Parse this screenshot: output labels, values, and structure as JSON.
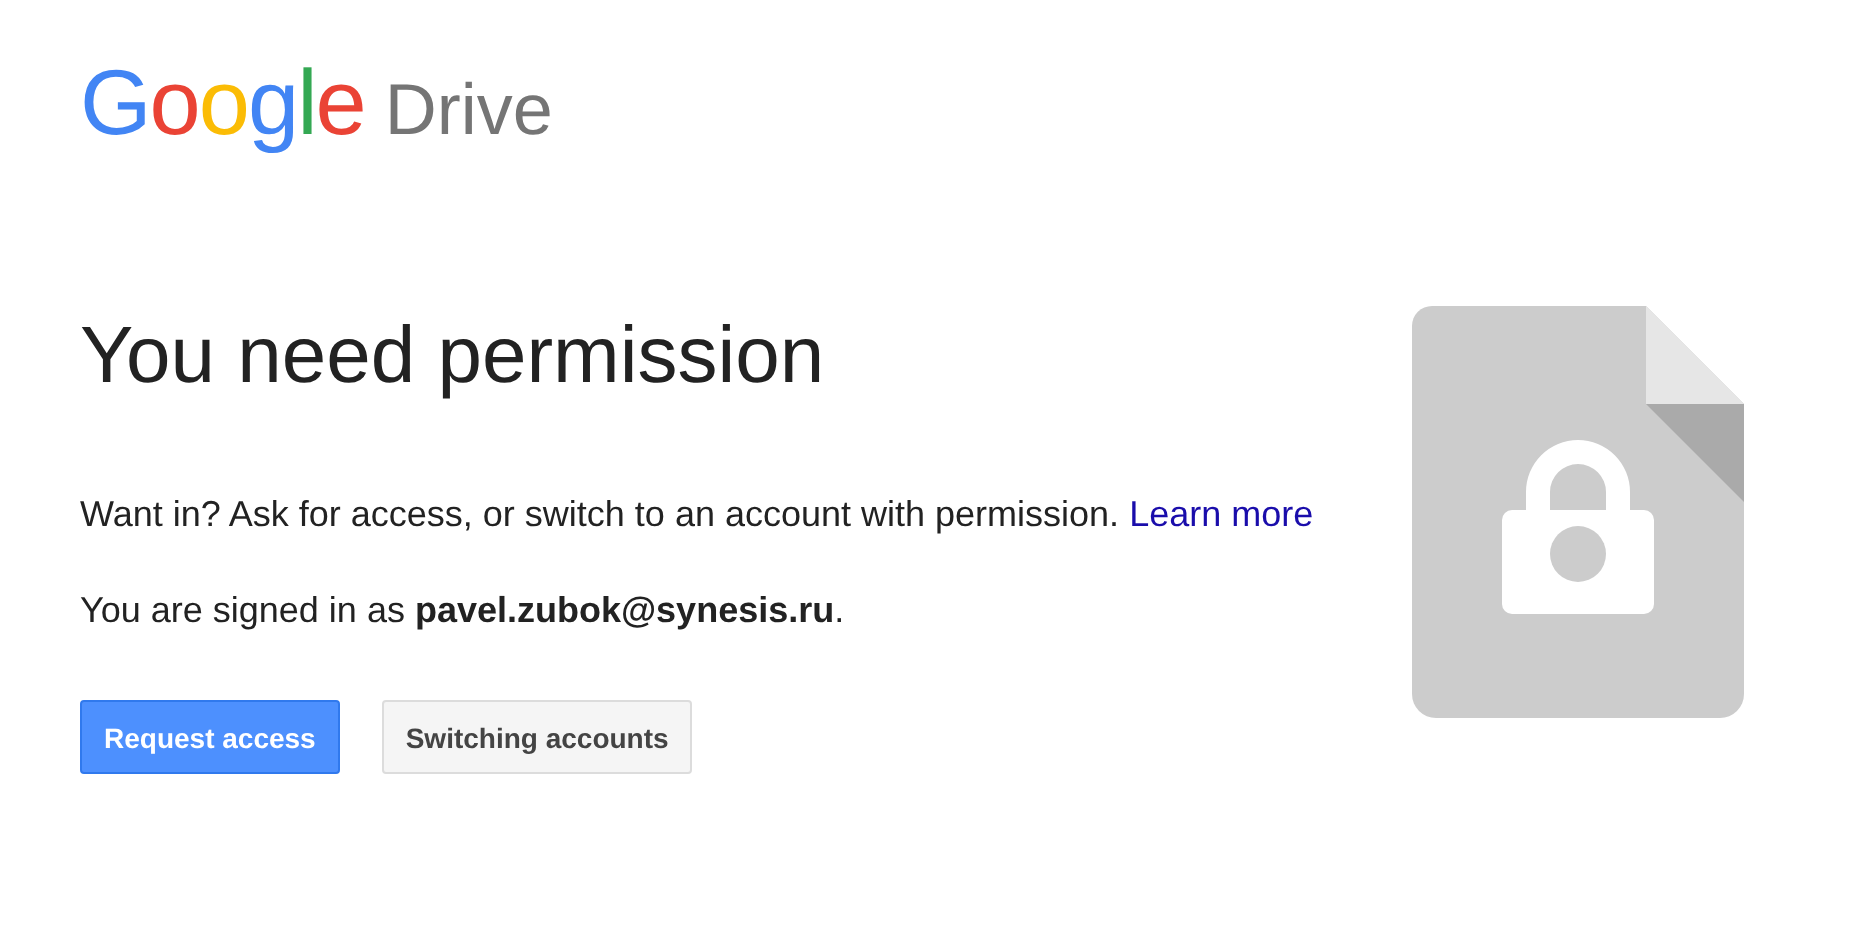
{
  "logo": {
    "brand": "Google",
    "product": "Drive"
  },
  "heading": "You need permission",
  "message": {
    "text": "Want in? Ask for access, or switch to an account with permission.",
    "link": "Learn more"
  },
  "signed_in": "You are signed in as **pavel.zubok@synesis.ru**.",
  "buttons": [
    {
      "label": "Request access",
      "kind": "primary"
    },
    {
      "label": "Switching accounts",
      "kind": "secondary"
    }
  ]
}
